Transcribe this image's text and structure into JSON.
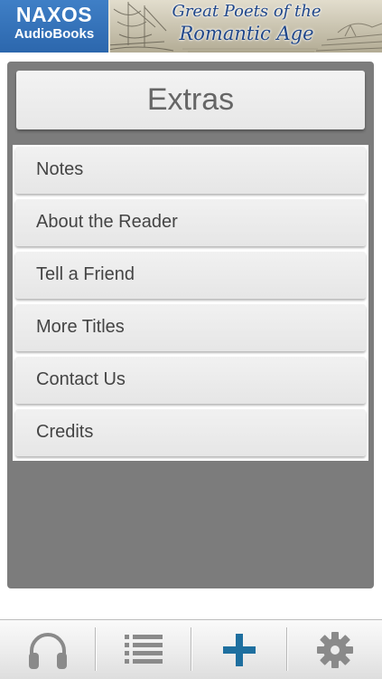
{
  "banner": {
    "logo_brand": "NAXOS",
    "logo_sub": "AudioBooks",
    "title_line1": "Great Poets of the",
    "title_line2": "Romantic Age"
  },
  "screen": {
    "title": "Extras"
  },
  "menu": {
    "items": [
      {
        "label": "Notes"
      },
      {
        "label": "About the Reader"
      },
      {
        "label": "Tell a Friend"
      },
      {
        "label": "More Titles"
      },
      {
        "label": "Contact Us"
      },
      {
        "label": "Credits"
      }
    ]
  },
  "tabbar": {
    "tabs": [
      {
        "icon": "headphones-icon",
        "selected": false
      },
      {
        "icon": "list-icon",
        "selected": false
      },
      {
        "icon": "plus-icon",
        "selected": true
      },
      {
        "icon": "gear-icon",
        "selected": false
      }
    ]
  },
  "colors": {
    "panel": "#7c7c7c",
    "accent": "#1e6f9f",
    "logo_blue": "#2f6eb8",
    "icon_gray": "#8a8a8a"
  }
}
